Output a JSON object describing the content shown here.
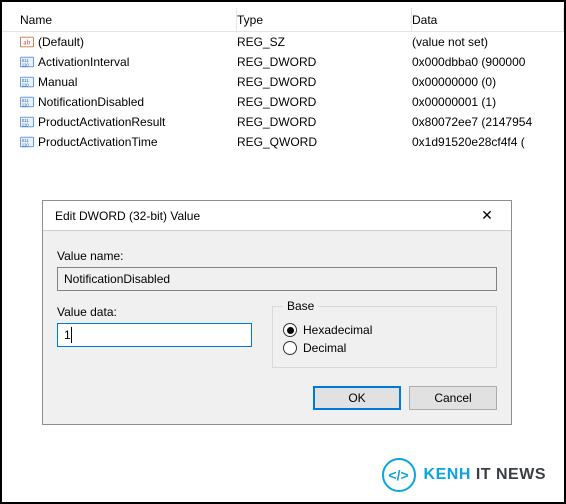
{
  "list": {
    "headers": {
      "name": "Name",
      "type": "Type",
      "data": "Data"
    },
    "rows": [
      {
        "kind": "sz",
        "name": "(Default)",
        "type": "REG_SZ",
        "data": "(value not set)"
      },
      {
        "kind": "num",
        "name": "ActivationInterval",
        "type": "REG_DWORD",
        "data": "0x000dbba0 (900000"
      },
      {
        "kind": "num",
        "name": "Manual",
        "type": "REG_DWORD",
        "data": "0x00000000 (0)"
      },
      {
        "kind": "num",
        "name": "NotificationDisabled",
        "type": "REG_DWORD",
        "data": "0x00000001 (1)"
      },
      {
        "kind": "num",
        "name": "ProductActivationResult",
        "type": "REG_DWORD",
        "data": "0x80072ee7 (2147954"
      },
      {
        "kind": "num",
        "name": "ProductActivationTime",
        "type": "REG_QWORD",
        "data": "0x1d91520e28cf4f4 ("
      }
    ]
  },
  "dialog": {
    "title": "Edit DWORD (32-bit) Value",
    "value_name_label": "Value name:",
    "value_name": "NotificationDisabled",
    "value_data_label": "Value data:",
    "value_data": "1",
    "base_legend": "Base",
    "base": {
      "hex": "Hexadecimal",
      "dec": "Decimal",
      "selected": "hex"
    },
    "ok": "OK",
    "cancel": "Cancel"
  },
  "watermark": {
    "badge": "</>",
    "brand_highlight": "KENH",
    "brand_rest": " IT NEWS"
  }
}
